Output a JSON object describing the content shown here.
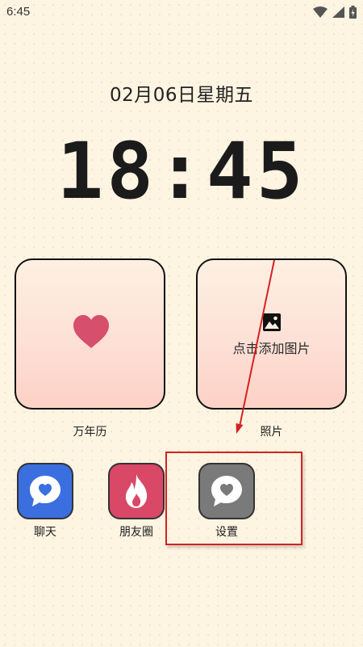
{
  "status_bar": {
    "time": "6:45",
    "icons": [
      "wifi-icon",
      "signal-icon",
      "battery-icon"
    ]
  },
  "date_text": "02月06日星期五",
  "clock_text": "18:45",
  "widgets": [
    {
      "label": "万年历",
      "icon": "heart-icon"
    },
    {
      "label": "照片",
      "icon": "image-icon",
      "hint": "点击添加图片"
    }
  ],
  "apps": [
    {
      "label": "聊天",
      "icon": "chat-heart-icon",
      "color": "#3b6fe0"
    },
    {
      "label": "朋友圈",
      "icon": "flame-icon",
      "color": "#d94866"
    },
    {
      "label": "设置",
      "icon": "chat-heart-icon",
      "color": "#7a7a7a"
    }
  ],
  "colors": {
    "background": "#fdf4e2",
    "annotation_red": "#d42222"
  }
}
